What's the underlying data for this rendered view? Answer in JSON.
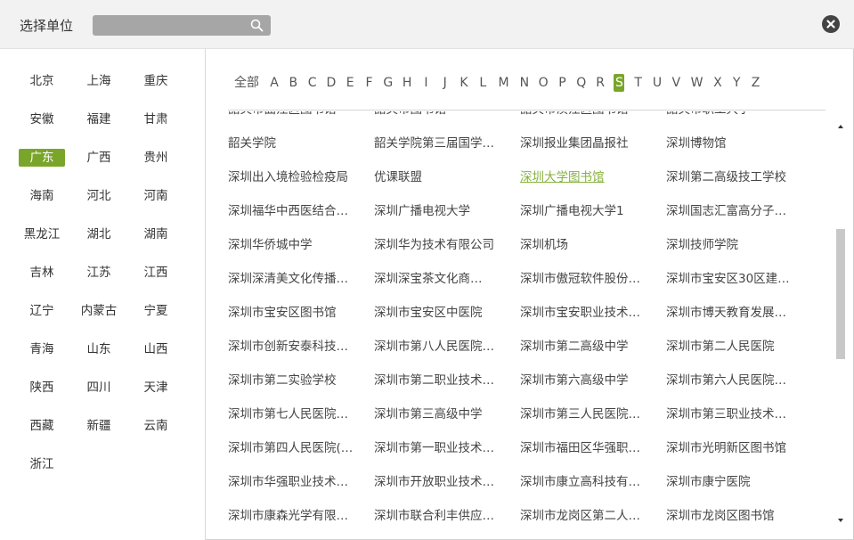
{
  "dialog": {
    "title": "选择单位",
    "search_placeholder": ""
  },
  "provinces": [
    "北京",
    "上海",
    "重庆",
    "安徽",
    "福建",
    "甘肃",
    "广东",
    "广西",
    "贵州",
    "海南",
    "河北",
    "河南",
    "黑龙江",
    "湖北",
    "湖南",
    "吉林",
    "江苏",
    "江西",
    "辽宁",
    "内蒙古",
    "宁夏",
    "青海",
    "山东",
    "山西",
    "陕西",
    "四川",
    "天津",
    "西藏",
    "新疆",
    "云南",
    "浙江"
  ],
  "active_province": "广东",
  "letters": [
    "全部",
    "A",
    "B",
    "C",
    "D",
    "E",
    "F",
    "G",
    "H",
    "I",
    "J",
    "K",
    "L",
    "M",
    "N",
    "O",
    "P",
    "Q",
    "R",
    "S",
    "T",
    "U",
    "V",
    "W",
    "X",
    "Y",
    "Z"
  ],
  "active_letter": "S",
  "units": [
    [
      "韶关市曲江区图书馆",
      "韶关市图书馆",
      "韶关市浈江区图书馆",
      "韶关市职工大学"
    ],
    [
      "韶关学院",
      "韶关学院第三届国学…",
      "深圳报业集团晶报社",
      "深圳博物馆"
    ],
    [
      "深圳出入境检验检疫局",
      "优课联盟",
      "深圳大学图书馆",
      "深圳第二高级技工学校"
    ],
    [
      "深圳福华中西医结合…",
      "深圳广播电视大学",
      "深圳广播电视大学1",
      "深圳国志汇富高分子…"
    ],
    [
      "深圳华侨城中学",
      "深圳华为技术有限公司",
      "深圳机场",
      "深圳技师学院"
    ],
    [
      "深圳深清美文化传播…",
      "深圳深宝茶文化商…",
      "深圳市傲冠软件股份…",
      "深圳市宝安区30区建…"
    ],
    [
      "深圳市宝安区图书馆",
      "深圳市宝安区中医院",
      "深圳市宝安职业技术…",
      "深圳市博天教育发展…"
    ],
    [
      "深圳市创新安泰科技…",
      "深圳市第八人民医院…",
      "深圳市第二高级中学",
      "深圳市第二人民医院"
    ],
    [
      "深圳市第二实验学校",
      "深圳市第二职业技术…",
      "深圳市第六高级中学",
      "深圳市第六人民医院…"
    ],
    [
      "深圳市第七人民医院…",
      "深圳市第三高级中学",
      "深圳市第三人民医院…",
      "深圳市第三职业技术…"
    ],
    [
      "深圳市第四人民医院(…",
      "深圳市第一职业技术…",
      "深圳市福田区华强职…",
      "深圳市光明新区图书馆"
    ],
    [
      "深圳市华强职业技术…",
      "深圳市开放职业技术…",
      "深圳市康立高科技有…",
      "深圳市康宁医院"
    ],
    [
      "深圳市康森光学有限…",
      "深圳市联合利丰供应…",
      "深圳市龙岗区第二人…",
      "深圳市龙岗区图书馆"
    ]
  ],
  "highlighted_unit": "深圳大学图书馆",
  "colors": {
    "accent": "#7aa52b",
    "link": "#86b13d",
    "header_bg": "#f2f2f2",
    "search_bg": "#a6a6a6"
  }
}
